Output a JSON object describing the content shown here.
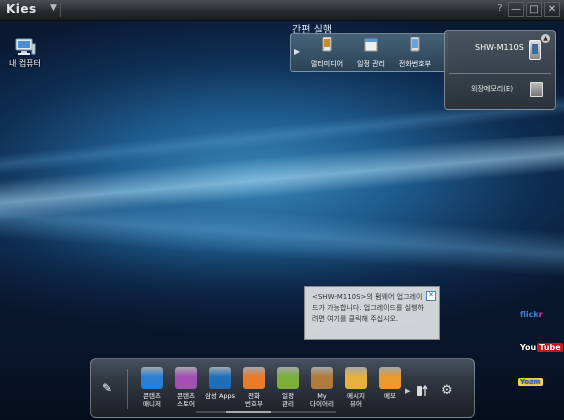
{
  "app": {
    "logo": "Kies"
  },
  "window_controls": {
    "help": "?",
    "minimize": "—",
    "maximize": "□",
    "close": "✕"
  },
  "desktop": {
    "my_computer_label": "내 컴퓨터"
  },
  "quick_launch": {
    "title": "간편 실행",
    "items": [
      {
        "label": "멀티미디어",
        "icon": "multimedia-icon"
      },
      {
        "label": "일정 관리",
        "icon": "calendar-icon"
      },
      {
        "label": "전화번호부",
        "icon": "phonebook-icon"
      }
    ]
  },
  "device": {
    "name": "SHW-M110S",
    "memory_label": "외장메모리(E)"
  },
  "notification": {
    "text": "<SHW-M110S>의 펌웨어 업그레이드가 가능합니다. 업그레이드를 실행하려면 여기를 클릭해 주십시오."
  },
  "services": {
    "flickr_a": "flick",
    "flickr_b": "r",
    "youtube_a": "You",
    "youtube_b": "Tube",
    "other": "Yozm"
  },
  "dock": {
    "items": [
      {
        "label": "콘텐츠\n매니저",
        "icon": "content-manager-icon",
        "color": "#2b7fd3"
      },
      {
        "label": "콘텐츠\n스토어",
        "icon": "content-store-icon",
        "color": "#a34fb3"
      },
      {
        "label": "삼성 Apps",
        "icon": "samsung-apps-icon",
        "color": "#1f6fb8"
      },
      {
        "label": "전화\n번호부",
        "icon": "phonebook-icon",
        "color": "#e87a2a"
      },
      {
        "label": "일정\n관리",
        "icon": "calendar-icon",
        "color": "#7cae3a"
      },
      {
        "label": "My\n다이어리",
        "icon": "diary-icon",
        "color": "#b07a3a"
      },
      {
        "label": "메시지\n뷰어",
        "icon": "message-viewer-icon",
        "color": "#e8b040"
      },
      {
        "label": "메모",
        "icon": "memo-icon",
        "color": "#e89a2a"
      }
    ]
  }
}
